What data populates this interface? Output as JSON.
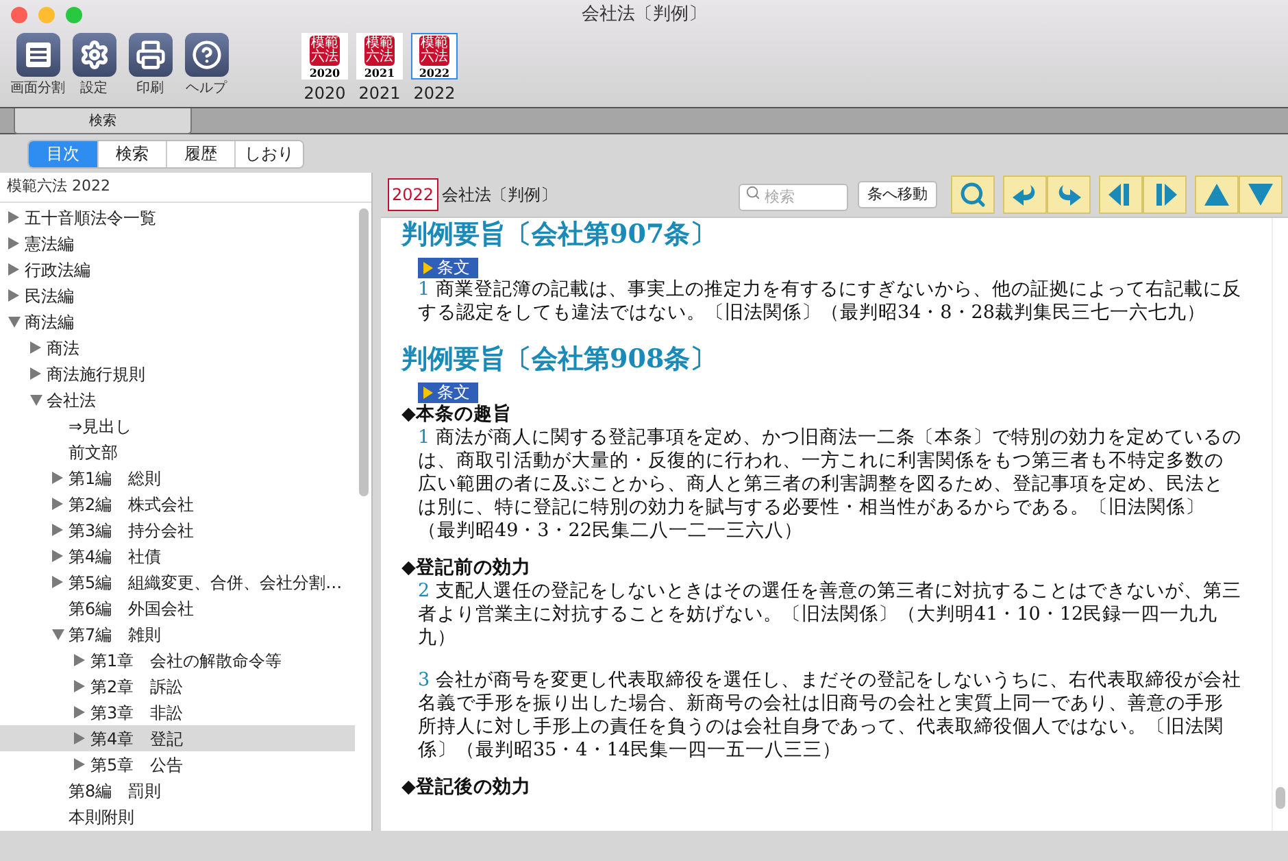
{
  "window": {
    "title": "会社法〔判例〕"
  },
  "toolbar": {
    "buttons": [
      {
        "kind": "split",
        "label": "画面分割"
      },
      {
        "kind": "settings",
        "label": "設定"
      },
      {
        "kind": "print",
        "label": "印刷"
      },
      {
        "kind": "help",
        "label": "ヘルプ"
      }
    ],
    "books": [
      {
        "cover_title": "模範六法",
        "cover_year": "2020",
        "label": "2020",
        "selected": false
      },
      {
        "cover_title": "模範六法",
        "cover_year": "2021",
        "label": "2021",
        "selected": false
      },
      {
        "cover_title": "模範六法",
        "cover_year": "2022",
        "label": "2022",
        "selected": true
      }
    ]
  },
  "tab_bar": {
    "tabs": [
      "検索"
    ]
  },
  "segments": [
    {
      "label": "目次",
      "selected": true
    },
    {
      "label": "検索",
      "selected": false
    },
    {
      "label": "履歴",
      "selected": false
    },
    {
      "label": "しおり",
      "selected": false
    }
  ],
  "sidebar": {
    "header": "模範六法 2022",
    "items": [
      {
        "label": "五十音順法令一覧",
        "kind": "folder",
        "expanded": false,
        "selected": false
      },
      {
        "label": "憲法編",
        "kind": "folder",
        "expanded": false,
        "selected": false
      },
      {
        "label": "行政法編",
        "kind": "folder",
        "expanded": false,
        "selected": false
      },
      {
        "label": "民法編",
        "kind": "folder",
        "expanded": false,
        "selected": false
      },
      {
        "label": "商法編",
        "kind": "folder",
        "expanded": true,
        "selected": false,
        "children": [
          {
            "label": "商法",
            "kind": "folder",
            "expanded": false,
            "selected": false
          },
          {
            "label": "商法施行規則",
            "kind": "folder",
            "expanded": false,
            "selected": false
          },
          {
            "label": "会社法",
            "kind": "folder",
            "expanded": true,
            "selected": false,
            "children": [
              {
                "label": "⇒見出し",
                "kind": "leaf",
                "selected": false
              },
              {
                "label": "前文部",
                "kind": "leaf",
                "selected": false
              },
              {
                "label": "第1編　総則",
                "kind": "folder",
                "expanded": false,
                "selected": false
              },
              {
                "label": "第2編　株式会社",
                "kind": "folder",
                "expanded": false,
                "selected": false
              },
              {
                "label": "第3編　持分会社",
                "kind": "folder",
                "expanded": false,
                "selected": false
              },
              {
                "label": "第4編　社債",
                "kind": "folder",
                "expanded": false,
                "selected": false
              },
              {
                "label": "第5編　組織変更、合併、会社分割…",
                "kind": "folder",
                "expanded": false,
                "selected": false
              },
              {
                "label": "第6編　外国会社",
                "kind": "leaf",
                "selected": false
              },
              {
                "label": "第7編　雑則",
                "kind": "folder",
                "expanded": true,
                "selected": false,
                "children": [
                  {
                    "label": "第1章　会社の解散命令等",
                    "kind": "folder",
                    "expanded": false,
                    "selected": false
                  },
                  {
                    "label": "第2章　訴訟",
                    "kind": "folder",
                    "expanded": false,
                    "selected": false
                  },
                  {
                    "label": "第3章　非訟",
                    "kind": "folder",
                    "expanded": false,
                    "selected": false
                  },
                  {
                    "label": "第4章　登記",
                    "kind": "folder",
                    "expanded": false,
                    "selected": true
                  },
                  {
                    "label": "第5章　公告",
                    "kind": "folder",
                    "expanded": false,
                    "selected": false
                  }
                ]
              },
              {
                "label": "第8編　罰則",
                "kind": "leaf",
                "selected": false
              },
              {
                "label": "本則附則",
                "kind": "leaf",
                "selected": false
              }
            ]
          }
        ]
      }
    ]
  },
  "document": {
    "badge": "2022",
    "title": "会社法〔判例〕",
    "search": {
      "placeholder": "検索"
    },
    "jump_button": "条へ移動",
    "blocks": [
      {
        "kind": "heading",
        "text": "判例要旨〔会社第907条〕"
      },
      {
        "kind": "link",
        "text": "条文"
      },
      {
        "kind": "paragraph",
        "number": "1",
        "text": "商業登記簿の記載は、事実上の推定力を有するにすぎないから、他の証拠によって右記載に反する認定をしても違法ではない。〔旧法関係〕（最判昭34・8・28裁判集民三七一六七九）"
      },
      {
        "kind": "heading",
        "text": "判例要旨〔会社第908条〕"
      },
      {
        "kind": "link",
        "text": "条文"
      },
      {
        "kind": "subheading",
        "text": "◆本条の趣旨"
      },
      {
        "kind": "paragraph",
        "number": "1",
        "text": "商法が商人に関する登記事項を定め、かつ旧商法一二条〔本条〕で特別の効力を定めているのは、商取引活動が大量的・反復的に行われ、一方これに利害関係をもつ第三者も不特定多数の広い範囲の者に及ぶことから、商人と第三者の利害調整を図るため、登記事項を定め、民法とは別に、特に登記に特別の効力を賦与する必要性・相当性があるからである。〔旧法関係〕（最判昭49・3・22民集二八一二一三六八）"
      },
      {
        "kind": "subheading",
        "text": "◆登記前の効力"
      },
      {
        "kind": "paragraph",
        "number": "2",
        "text": "支配人選任の登記をしないときはその選任を善意の第三者に対抗することはできないが、第三者より営業主に対抗することを妨げない。〔旧法関係〕（大判明41・10・12民録一四一九九九）"
      },
      {
        "kind": "paragraph",
        "number": "3",
        "text": "会社が商号を変更し代表取締役を選任し、まだその登記をしないうちに、右代表取締役が会社名義で手形を振り出した場合、新商号の会社は旧商号の会社と実質上同一であり、善意の手形所持人に対し手形上の責任を負うのは会社自身であって、代表取締役個人ではない。〔旧法関係〕（最判昭35・4・14民集一四一五一八三三）"
      },
      {
        "kind": "subheading",
        "text": "◆登記後の効力"
      }
    ]
  }
}
